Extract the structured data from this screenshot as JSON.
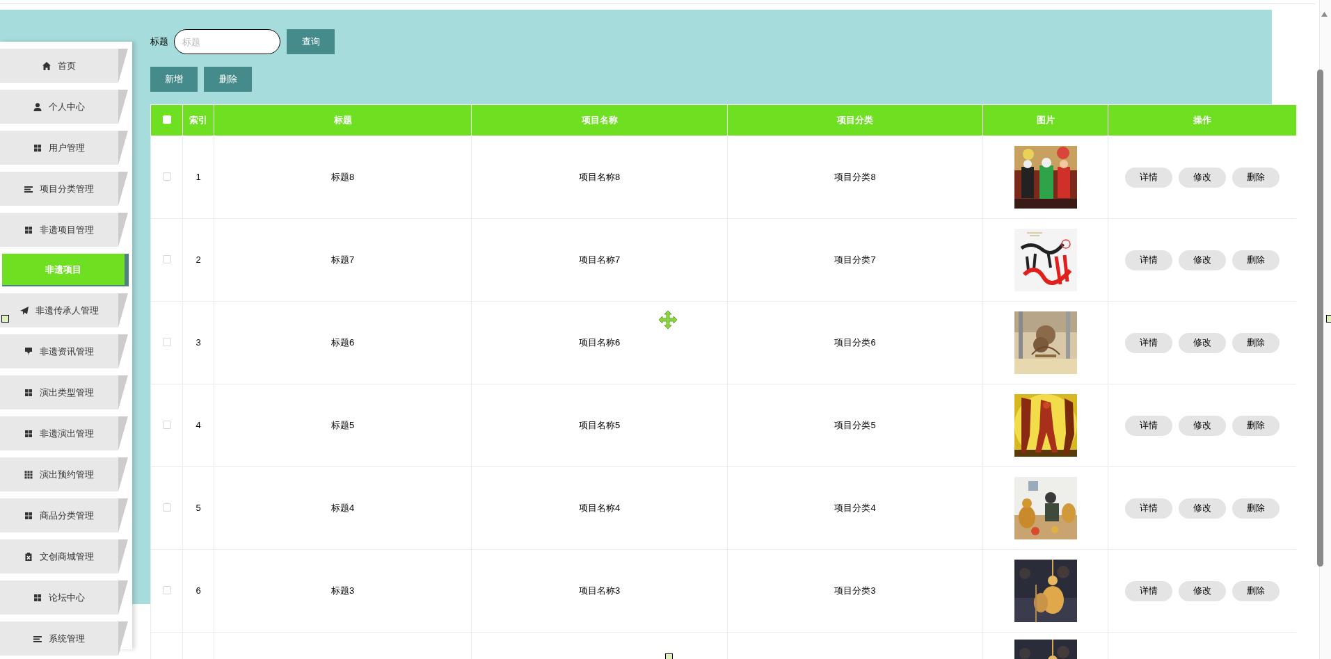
{
  "sidebar": {
    "items": [
      {
        "label": "首页",
        "selected": false
      },
      {
        "label": "个人中心",
        "selected": false
      },
      {
        "label": "用户管理",
        "selected": false
      },
      {
        "label": "项目分类管理",
        "selected": false
      },
      {
        "label": "非遗项目管理",
        "selected": false
      },
      {
        "label": "非遗项目",
        "selected": true
      },
      {
        "label": "非遗传承人管理",
        "selected": false
      },
      {
        "label": "非遗资讯管理",
        "selected": false
      },
      {
        "label": "演出类型管理",
        "selected": false
      },
      {
        "label": "非遗演出管理",
        "selected": false
      },
      {
        "label": "演出预约管理",
        "selected": false
      },
      {
        "label": "商品分类管理",
        "selected": false
      },
      {
        "label": "文创商城管理",
        "selected": false
      },
      {
        "label": "论坛中心",
        "selected": false
      },
      {
        "label": "系统管理",
        "selected": false
      }
    ]
  },
  "search": {
    "label": "标题",
    "placeholder": "标题",
    "button": "查询"
  },
  "actions": [
    "新增",
    "删除"
  ],
  "table": {
    "header_checkbox": {
      "checked": false
    },
    "columns": [
      "索引",
      "标题",
      "项目名称",
      "项目分类",
      "图片",
      "操作"
    ],
    "rows": [
      {
        "checked": false,
        "index": "1",
        "title": "标题8",
        "name": "项目名称8",
        "category": "项目分类8",
        "image": {
          "kind": "picture"
        },
        "actions": [
          "详情",
          "修改",
          "删除"
        ]
      },
      {
        "checked": false,
        "index": "2",
        "title": "标题7",
        "name": "项目名称7",
        "category": "项目分类7",
        "image": {
          "kind": "picture"
        },
        "actions": [
          "详情",
          "修改",
          "删除"
        ]
      },
      {
        "checked": false,
        "index": "3",
        "title": "标题6",
        "name": "项目名称6",
        "category": "项目分类6",
        "image": {
          "kind": "picture"
        },
        "actions": [
          "详情",
          "修改",
          "删除"
        ]
      },
      {
        "checked": false,
        "index": "4",
        "title": "标题5",
        "name": "项目名称5",
        "category": "项目分类5",
        "image": {
          "kind": "picture"
        },
        "actions": [
          "详情",
          "修改",
          "删除"
        ]
      },
      {
        "checked": false,
        "index": "5",
        "title": "标题4",
        "name": "项目名称4",
        "category": "项目分类4",
        "image": {
          "kind": "picture"
        },
        "actions": [
          "详情",
          "修改",
          "删除"
        ]
      },
      {
        "checked": false,
        "index": "6",
        "title": "标题3",
        "name": "项目名称3",
        "category": "项目分类3",
        "image": {
          "kind": "picture"
        },
        "actions": [
          "详情",
          "修改",
          "删除"
        ]
      },
      {
        "image": {
          "kind": "picture"
        }
      }
    ]
  }
}
